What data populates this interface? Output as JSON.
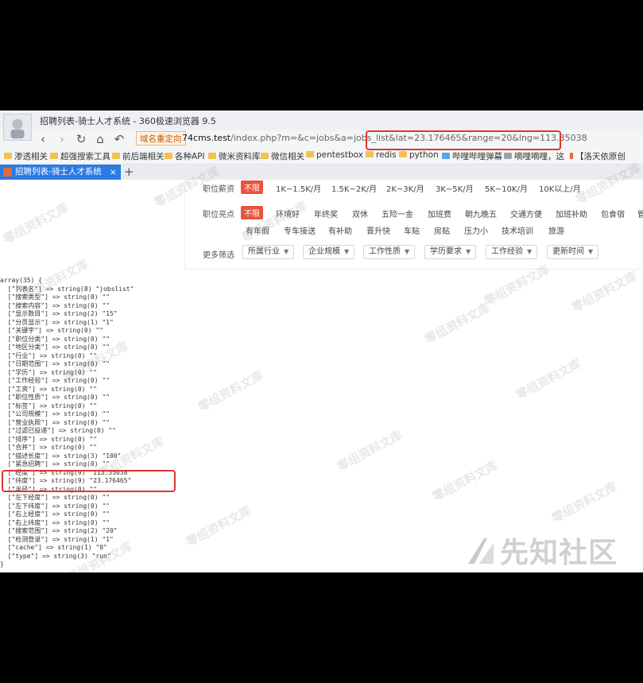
{
  "browser": {
    "window_title": "招聘列表-骑士人才系统 - 360极速浏览器 9.5",
    "url_badge": "域名重定向",
    "url_host": "74cms.test",
    "url_path": "/index.php?m=&c=jobs&a=jobs_list&lat=23.176465&range=20&lng=113.35038",
    "bookmarks": [
      "渗透相关",
      "超强搜索工具",
      "前后端相关",
      "各种API",
      "微米资料库",
      "微信相关",
      "pentestbox",
      "redis",
      "python",
      "哔哩哔哩弹幕",
      "嘀哩嘀哩，这",
      "【洛天依原创"
    ],
    "tab_title": "招聘列表-骑士人才系统",
    "tab_close": "×",
    "new_tab": "+"
  },
  "filters": {
    "salary": {
      "label": "职位薪资",
      "options": [
        "不限",
        "1K~1.5K/月",
        "1.5K~2K/月",
        "2K~3K/月",
        "3K~5K/月",
        "5K~10K/月",
        "10K以上/月"
      ]
    },
    "highlights": {
      "label": "职位亮点",
      "row1": [
        "不限",
        "环境好",
        "年终奖",
        "双休",
        "五险一金",
        "加班费",
        "朝九晚五",
        "交通方便",
        "加班补助",
        "包食宿",
        "管"
      ],
      "row2": [
        "有年假",
        "专车接送",
        "有补助",
        "晋升快",
        "车贴",
        "房贴",
        "压力小",
        "技术培训",
        "旅游"
      ]
    },
    "more": {
      "label": "更多筛选",
      "dropdowns": [
        "所属行业",
        "企业规模",
        "工作性质",
        "学历要求",
        "工作经验",
        "更新时间"
      ]
    }
  },
  "dump_lines": [
    "array(35) {",
    "  [\"列表名\"] => string(8) \"jobslist\"",
    "  [\"搜索类型\"] => string(0) \"\"",
    "  [\"搜索内容\"] => string(0) \"\"",
    "  [\"显示数目\"] => string(2) \"15\"",
    "  [\"分页显示\"] => string(1) \"1\"",
    "  [\"关键字\"] => string(0) \"\"",
    "  [\"职位分类\"] => string(0) \"\"",
    "  [\"地区分类\"] => string(0) \"\"",
    "  [\"行业\"] => string(0) \"\"",
    "  [\"日期范围\"] => string(0) \"\"",
    "  [\"学历\"] => string(0) \"\"",
    "  [\"工作经验\"] => string(0) \"\"",
    "  [\"工资\"] => string(0) \"\"",
    "  [\"职位性质\"] => string(0) \"\"",
    "  [\"标签\"] => string(0) \"\"",
    "  [\"公司规模\"] => string(0) \"\"",
    "  [\"营业执照\"] => string(0) \"\"",
    "  [\"过滤已投递\"] => string(0) \"\"",
    "  [\"排序\"] => string(0) \"\"",
    "  [\"合并\"] => string(0) \"\"",
    "  [\"描述长度\"] => string(3) \"100\"",
    "  [\"紧急招聘\"] => string(0) \"\"",
    "  [\"经度\"] => string(9) \"113.35038\"",
    "  [\"纬度\"] => string(9) \"23.176465\"",
    "  [\"半径\"] => string(0) \"\"",
    "  [\"左下经度\"] => string(0) \"\"",
    "  [\"左下纬度\"] => string(0) \"\"",
    "  [\"右上经度\"] => string(0) \"\"",
    "  [\"右上纬度\"] => string(0) \"\"",
    "  [\"搜索范围\"] => string(2) \"20\"",
    "  [\"检测登录\"] => string(1) \"1\"",
    "  [\"cache\"] => string(1) \"0\"",
    "  [\"type\"] => string(3) \"run\"",
    "}"
  ],
  "watermark_text": "零组资料文库",
  "brand_logo": "先知社区",
  "colors": {
    "tab_active": "#2b7be3",
    "filter_selected": "#e8533c",
    "highlight_box": "#e3342f",
    "url_badge": "#c95a00"
  }
}
